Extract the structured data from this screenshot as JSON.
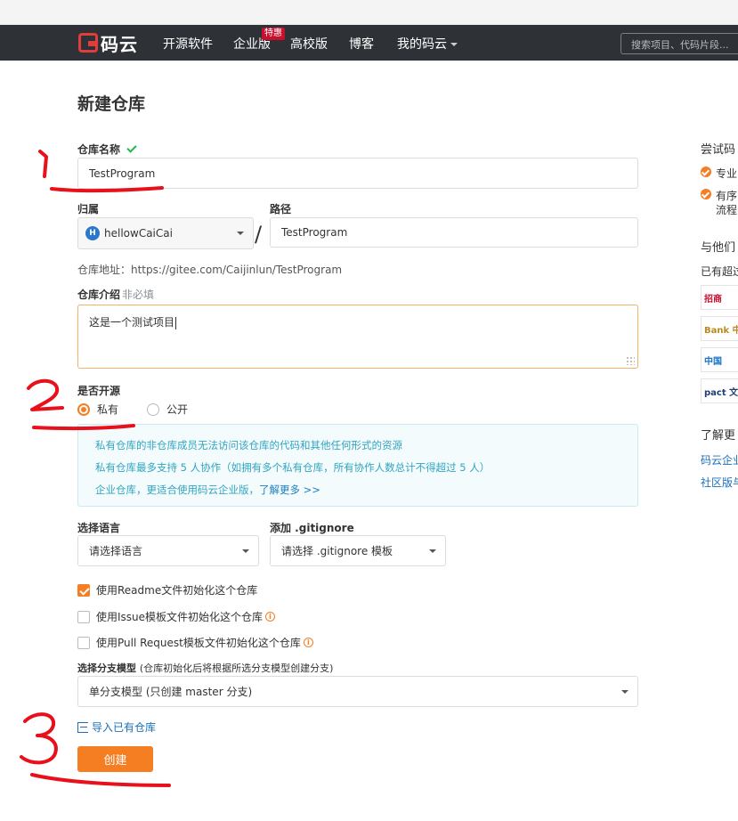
{
  "nav": {
    "logo_text": "码云",
    "items": [
      "开源软件",
      "企业版",
      "高校版",
      "博客",
      "我的码云"
    ],
    "badge": "特惠",
    "search_placeholder": "搜索项目、代码片段..."
  },
  "form": {
    "page_title": "新建仓库",
    "repo_name_label": "仓库名称",
    "repo_name_value": "TestProgram",
    "owner_label": "归属",
    "owner_value": "hellowCaiCai",
    "owner_avatar": "H",
    "path_label": "路径",
    "path_value": "TestProgram",
    "url_text": "仓库地址：https://gitee.com/Caijinlun/TestProgram",
    "desc_label": "仓库介绍",
    "desc_optional": "非必填",
    "desc_value": "这是一个测试项目",
    "visibility_label": "是否开源",
    "visibility_private": "私有",
    "visibility_public": "公开",
    "visibility_selected": "私有",
    "notice": [
      "私有仓库的非仓库成员无法访问该仓库的代码和其他任何形式的资源",
      "私有仓库最多支持 5 人协作（如拥有多个私有仓库，所有协作人数总计不得超过 5 人）",
      "企业仓库，更适合使用码云企业版，"
    ],
    "notice_link": "了解更多 >>",
    "language_label": "选择语言",
    "language_value": "请选择语言",
    "gitignore_label": "添加 .gitignore",
    "gitignore_value": "请选择 .gitignore 模板",
    "checkbox_readme": "使用Readme文件初始化这个仓库",
    "checkbox_issue": "使用Issue模板文件初始化这个仓库",
    "checkbox_pr": "使用Pull Request模板文件初始化这个仓库",
    "branch_label": "选择分支模型",
    "branch_hint": "(仓库初始化后将根据所选分支模型创建分支)",
    "branch_value": "单分支模型 (只创建 master 分支)",
    "import_link": "导入已有仓库",
    "create_button": "创建"
  },
  "sidebar": {
    "try_title": "尝试码",
    "feature1": "专业",
    "feature2a": "有序",
    "feature2b": "流程",
    "with_title": "与他们",
    "used_by": "已有超过",
    "logos": [
      "招商",
      "Bank 中",
      "中国",
      "pact 文思"
    ],
    "learn_title": "了解更",
    "link1": "码云企业",
    "link2": "社区版与"
  },
  "annotations": [
    "1",
    "2",
    "3"
  ],
  "colors": {
    "accent": "#f57d22",
    "nav_bg": "#2e3136",
    "notice_text": "#2fa5c0",
    "annotation": "#e8101b"
  }
}
